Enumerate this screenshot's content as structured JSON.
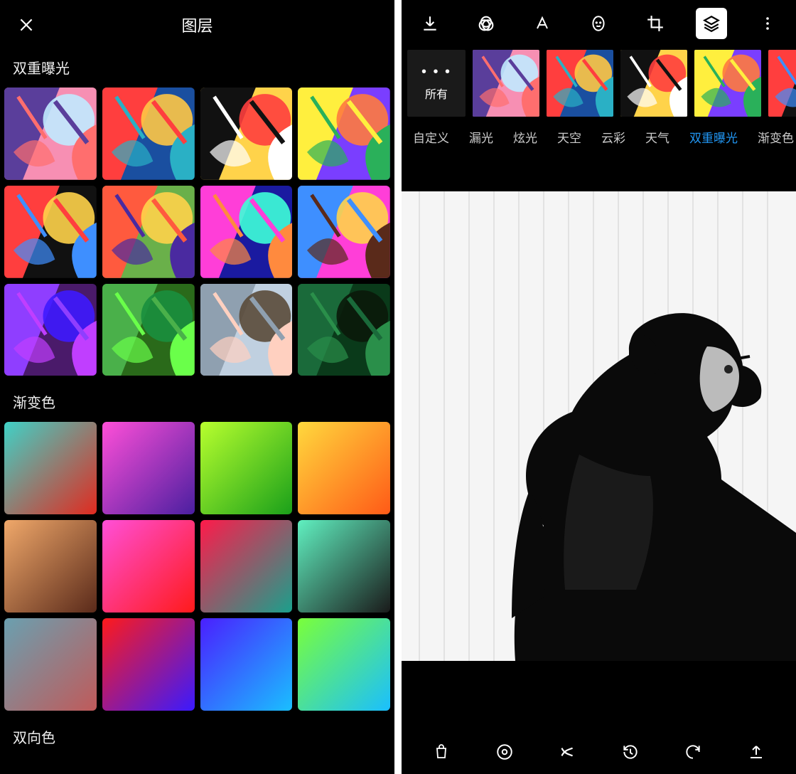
{
  "left": {
    "title": "图层",
    "section_double_exposure": "双重曝光",
    "section_gradient": "渐变色",
    "section_duotone": "双向色",
    "gradients": [
      {
        "c1": "#3fd2c7",
        "c2": "#e12a1f"
      },
      {
        "c1": "#ff4fd8",
        "c2": "#4a1fa0"
      },
      {
        "c1": "#b8ff2e",
        "c2": "#1aa01a"
      },
      {
        "c1": "#ffd93d",
        "c2": "#ff5a17"
      },
      {
        "c1": "#f0a86a",
        "c2": "#5a2a1a"
      },
      {
        "c1": "#ff4fd8",
        "c2": "#ff1a1a"
      },
      {
        "c1": "#ff1a4a",
        "c2": "#1aa08c"
      },
      {
        "c1": "#60f0c0",
        "c2": "#1a1a1a"
      },
      {
        "c1": "#6aa0b0",
        "c2": "#c05a5a"
      },
      {
        "c1": "#ff1a1a",
        "c2": "#3a1aff"
      },
      {
        "c1": "#4a1fff",
        "c2": "#1abfff"
      },
      {
        "c1": "#7aff3a",
        "c2": "#1abfff"
      }
    ]
  },
  "right": {
    "all_label": "所有",
    "categories": [
      {
        "label": "自定义",
        "active": false
      },
      {
        "label": "漏光",
        "active": false
      },
      {
        "label": "炫光",
        "active": false
      },
      {
        "label": "天空",
        "active": false
      },
      {
        "label": "云彩",
        "active": false
      },
      {
        "label": "天气",
        "active": false
      },
      {
        "label": "双重曝光",
        "active": true
      },
      {
        "label": "渐变色",
        "active": false
      }
    ],
    "toolbar_icons": [
      "download-icon",
      "rgb-icon",
      "text-icon",
      "face-icon",
      "crop-icon",
      "layers-icon",
      "more-icon"
    ],
    "bottom_icons": [
      "shop-icon",
      "focus-icon",
      "magic-icon",
      "history-icon",
      "undo-icon",
      "upload-icon"
    ]
  }
}
